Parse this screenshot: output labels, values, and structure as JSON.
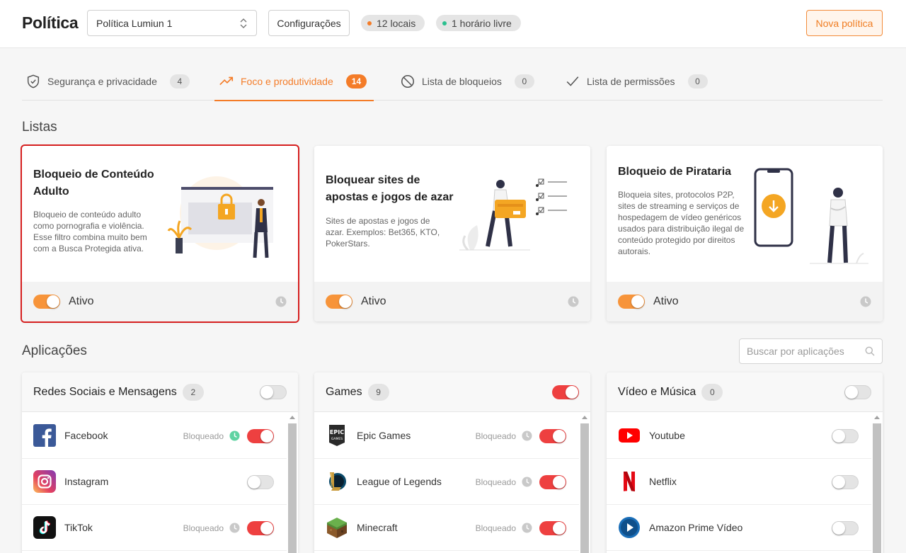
{
  "header": {
    "title": "Política",
    "policy_select": "Política Lumiun 1",
    "config_label": "Configurações",
    "locations_pill": "12 locais",
    "locations_dot_color": "#f47c28",
    "free_time_pill": "1 horário livre",
    "free_time_dot_color": "#2bc08f",
    "new_policy_label": "Nova política"
  },
  "tabs": [
    {
      "label": "Segurança e privacidade",
      "count": "4",
      "icon": "shield-check-icon"
    },
    {
      "label": "Foco e produtividade",
      "count": "14",
      "icon": "trending-up-icon"
    },
    {
      "label": "Lista de bloqueios",
      "count": "0",
      "icon": "block-icon"
    },
    {
      "label": "Lista de permissões",
      "count": "0",
      "icon": "check-icon"
    }
  ],
  "lists_section": {
    "title": "Listas",
    "cards": [
      {
        "title": "Bloqueio de Conteúdo Adulto",
        "description": "Bloqueio de conteúdo adulto como pornografia e violência. Esse filtro combina muito bem com a Busca Protegida ativa.",
        "status": "Ativo"
      },
      {
        "title": "Bloquear sites de apostas e jogos de azar",
        "description": "Sites de apostas e jogos de azar. Exemplos: Bet365, KTO, PokerStars.",
        "status": "Ativo"
      },
      {
        "title": "Bloqueio de Pirataria",
        "description": "Bloqueia sites, protocolos P2P, sites de streaming e serviços de hospedagem de vídeo genéricos usados para distribuição ilegal de conteúdo protegido por direitos autorais.",
        "status": "Ativo"
      }
    ]
  },
  "apps_section": {
    "title": "Aplicações",
    "search_placeholder": "Buscar por aplicações",
    "categories": [
      {
        "title": "Redes Sociais e Mensagens",
        "count": "2",
        "enabled": false,
        "apps": [
          {
            "name": "Facebook",
            "status": "Bloqueado",
            "blocked": true,
            "schedule": true
          },
          {
            "name": "Instagram",
            "status": "",
            "blocked": false,
            "schedule": false
          },
          {
            "name": "TikTok",
            "status": "Bloqueado",
            "blocked": true,
            "schedule": false
          }
        ]
      },
      {
        "title": "Games",
        "count": "9",
        "enabled": true,
        "apps": [
          {
            "name": "Epic Games",
            "status": "Bloqueado",
            "blocked": true,
            "schedule": false
          },
          {
            "name": "League of Legends",
            "status": "Bloqueado",
            "blocked": true,
            "schedule": false
          },
          {
            "name": "Minecraft",
            "status": "Bloqueado",
            "blocked": true,
            "schedule": false
          }
        ]
      },
      {
        "title": "Vídeo e Música",
        "count": "0",
        "enabled": false,
        "apps": [
          {
            "name": "Youtube",
            "status": "",
            "blocked": false,
            "schedule": false
          },
          {
            "name": "Netflix",
            "status": "",
            "blocked": false,
            "schedule": false
          },
          {
            "name": "Amazon Prime Vídeo",
            "status": "",
            "blocked": false,
            "schedule": false
          }
        ]
      }
    ]
  },
  "colors": {
    "accent": "#f47c28",
    "toggle_on": "#f7943a",
    "blocked_toggle": "#ee4040",
    "highlight_outline": "#d61f1f"
  }
}
